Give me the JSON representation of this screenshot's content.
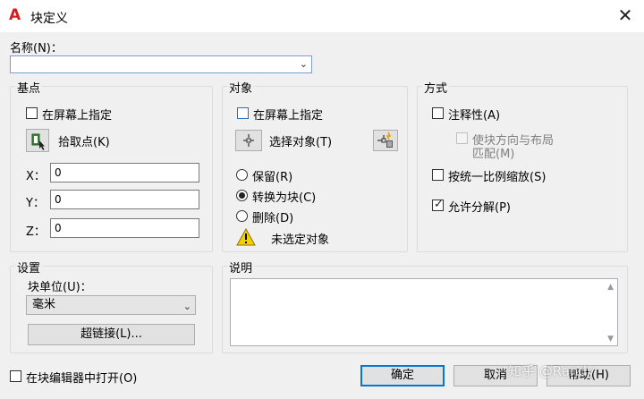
{
  "window": {
    "title": "块定义",
    "logo_letter": "A",
    "close_glyph": "✕"
  },
  "name": {
    "label": "名称(N)：",
    "value": ""
  },
  "basepoint": {
    "title": "基点",
    "specify_on_screen": "在屏幕上指定",
    "pick_point": "拾取点(K)",
    "x_label": "X：",
    "x_value": "0",
    "y_label": "Y：",
    "y_value": "0",
    "z_label": "Z：",
    "z_value": "0"
  },
  "objects": {
    "title": "对象",
    "specify_on_screen": "在屏幕上指定",
    "select_objects": "选择对象(T)",
    "retain": "保留(R)",
    "convert_to_block": "转换为块(C)",
    "delete": "删除(D)",
    "status": "未选定对象",
    "selected_option": "convert_to_block"
  },
  "behavior": {
    "title": "方式",
    "annotative": "注释性(A)",
    "match_orientation_line1": "使块方向与布局",
    "match_orientation_line2": "匹配(M)",
    "scale_uniformly": "按统一比例缩放(S)",
    "allow_exploding": "允许分解(P)",
    "allow_exploding_checked": true
  },
  "settings": {
    "title": "设置",
    "block_unit_label": "块单位(U)：",
    "block_unit_value": "毫米",
    "hyperlink_button": "超链接(L)..."
  },
  "description": {
    "title": "说明",
    "value": ""
  },
  "footer": {
    "open_in_editor": "在块编辑器中打开(O)",
    "ok": "确定",
    "cancel": "取消",
    "help": "帮助(H)"
  },
  "watermark": "知乎 @Randy",
  "colors": {
    "accent": "#0078d7",
    "logo_red": "#d21e1e",
    "warning_yellow": "#f5d000"
  }
}
